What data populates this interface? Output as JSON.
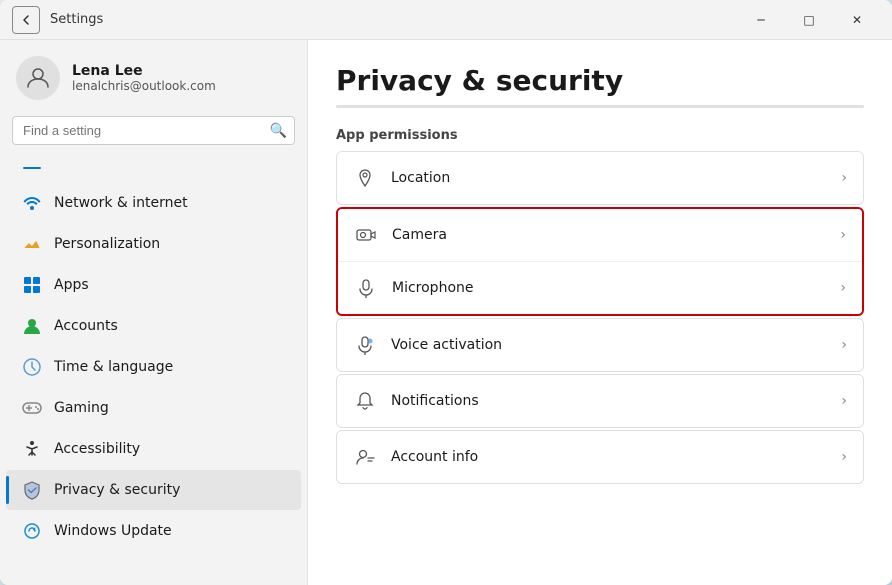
{
  "window": {
    "title": "Settings",
    "back_label": "←",
    "minimize_label": "─",
    "maximize_label": "□",
    "close_label": "✕"
  },
  "sidebar": {
    "user": {
      "name": "Lena Lee",
      "email": "lenalchris@outlook.com"
    },
    "search_placeholder": "Find a setting",
    "nav_items": [
      {
        "id": "home",
        "label": "",
        "icon": "home"
      },
      {
        "id": "network",
        "label": "Network & internet",
        "icon": "network"
      },
      {
        "id": "personalization",
        "label": "Personalization",
        "icon": "personalization"
      },
      {
        "id": "apps",
        "label": "Apps",
        "icon": "apps"
      },
      {
        "id": "accounts",
        "label": "Accounts",
        "icon": "accounts"
      },
      {
        "id": "time",
        "label": "Time & language",
        "icon": "time"
      },
      {
        "id": "gaming",
        "label": "Gaming",
        "icon": "gaming"
      },
      {
        "id": "accessibility",
        "label": "Accessibility",
        "icon": "accessibility"
      },
      {
        "id": "privacy",
        "label": "Privacy & security",
        "icon": "privacy",
        "active": true
      },
      {
        "id": "update",
        "label": "Windows Update",
        "icon": "update"
      }
    ]
  },
  "main": {
    "page_title": "Privacy & security",
    "section_label": "App permissions",
    "items": [
      {
        "id": "location",
        "label": "Location",
        "icon": "location"
      },
      {
        "id": "camera",
        "label": "Camera",
        "icon": "camera",
        "highlighted": true
      },
      {
        "id": "microphone",
        "label": "Microphone",
        "icon": "microphone",
        "highlighted": true
      },
      {
        "id": "voice",
        "label": "Voice activation",
        "icon": "voice"
      },
      {
        "id": "notifications",
        "label": "Notifications",
        "icon": "notifications"
      },
      {
        "id": "account-info",
        "label": "Account info",
        "icon": "account-info"
      }
    ]
  }
}
